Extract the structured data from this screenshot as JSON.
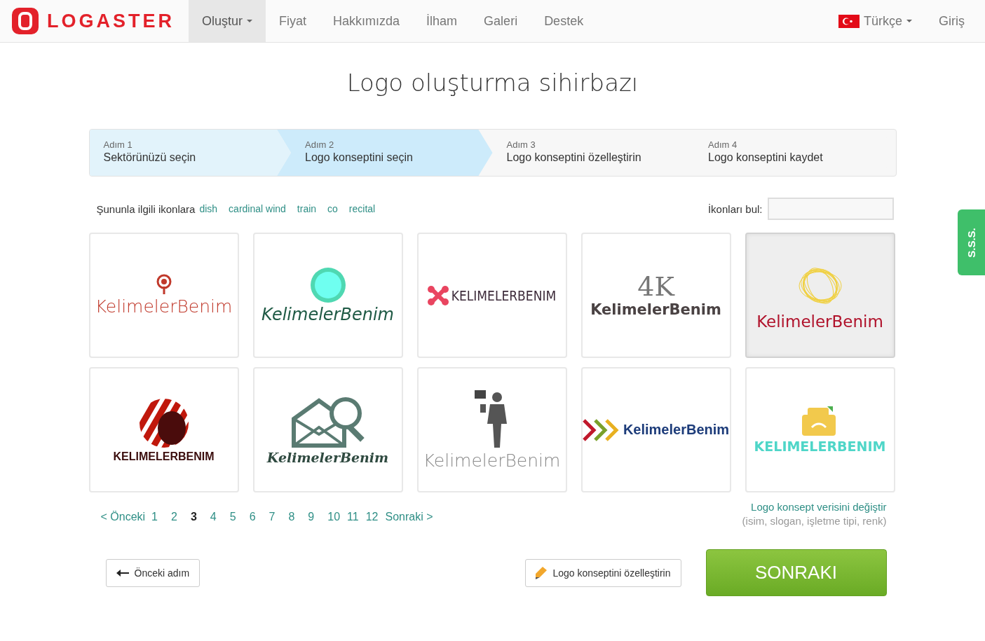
{
  "nav": {
    "brand": "LOGASTER",
    "items": [
      {
        "label": "Oluştur",
        "selected": true,
        "dropdown": true
      },
      {
        "label": "Fiyat",
        "selected": false,
        "dropdown": false
      },
      {
        "label": "Hakkımızda",
        "selected": false,
        "dropdown": false
      },
      {
        "label": "İlham",
        "selected": false,
        "dropdown": false
      },
      {
        "label": "Galeri",
        "selected": false,
        "dropdown": false
      },
      {
        "label": "Destek",
        "selected": false,
        "dropdown": false
      }
    ],
    "language": "Türkçe",
    "login": "Giriş"
  },
  "title": "Logo oluşturma sihirbazı",
  "steps": [
    {
      "step": "Adım 1",
      "label": "Sektörünüzü seçin",
      "completed": true,
      "selected": false
    },
    {
      "step": "Adım 2",
      "label": "Logo konseptini seçin",
      "completed": false,
      "selected": true
    },
    {
      "step": "Adım 3",
      "label": "Logo konseptini özelleştirin",
      "completed": false,
      "selected": false
    },
    {
      "step": "Adım 4",
      "label": "Logo konseptini kaydet",
      "completed": false,
      "selected": false
    }
  ],
  "keywords": {
    "label": "Şununla ilgili ikonlara",
    "items": [
      "dish",
      "cardinal wind",
      "train",
      "co",
      "recital"
    ]
  },
  "icon_search": {
    "label": "İkonları bul:"
  },
  "logos": [
    {
      "kind": "pin",
      "text": "KelimelerBenim",
      "color": "#c0392b",
      "selected": false
    },
    {
      "kind": "circle",
      "text": "KelimelerBenim",
      "color": "#1f5a45",
      "selected": false
    },
    {
      "kind": "cross",
      "text": "KELIMELERBENIM",
      "color": "#3d2b3a",
      "selected": false
    },
    {
      "kind": "monogram",
      "mark": "4K",
      "text": "KelimelerBenim",
      "color": "#4a4243",
      "selected": false
    },
    {
      "kind": "scribble",
      "text": "KelimelerBenim",
      "color": "#b0122b",
      "selected": true
    },
    {
      "kind": "sphere",
      "text": "KELIMELERBENIM",
      "color": "#3a0c0c",
      "selected": false
    },
    {
      "kind": "mail",
      "text": "KelimelerBenim",
      "color": "#2f4a40",
      "selected": false
    },
    {
      "kind": "person",
      "text": "KelimelerBenim",
      "color": "#8a8a8a",
      "selected": false
    },
    {
      "kind": "arrows",
      "text": "KelimelerBenim",
      "color": "#1d3c7a",
      "selected": false
    },
    {
      "kind": "phone",
      "text": "KELIMELERBENIM",
      "color": "#4fd6c8",
      "selected": false
    }
  ],
  "pagination": {
    "prev": "< Önceki",
    "next": "Sonraki >",
    "pages": [
      {
        "label": "1",
        "selected": false
      },
      {
        "label": "2",
        "selected": false
      },
      {
        "label": "3",
        "selected": true
      },
      {
        "label": "4",
        "selected": false
      },
      {
        "label": "5",
        "selected": false
      },
      {
        "label": "6",
        "selected": false
      },
      {
        "label": "7",
        "selected": false
      },
      {
        "label": "8",
        "selected": false
      },
      {
        "label": "9",
        "selected": false
      },
      {
        "label": "10",
        "selected": false
      },
      {
        "label": "11",
        "selected": false
      },
      {
        "label": "12",
        "selected": false
      }
    ]
  },
  "change_link": "Logo konsept verisini değiştir",
  "change_hint": "(isim, slogan, işletme tipi, renk)",
  "buttons": {
    "back": "Önceki adım",
    "customize": "Logo konseptini özelleştirin",
    "next": "SONRAKI"
  },
  "faq_tab": "S.S.S."
}
